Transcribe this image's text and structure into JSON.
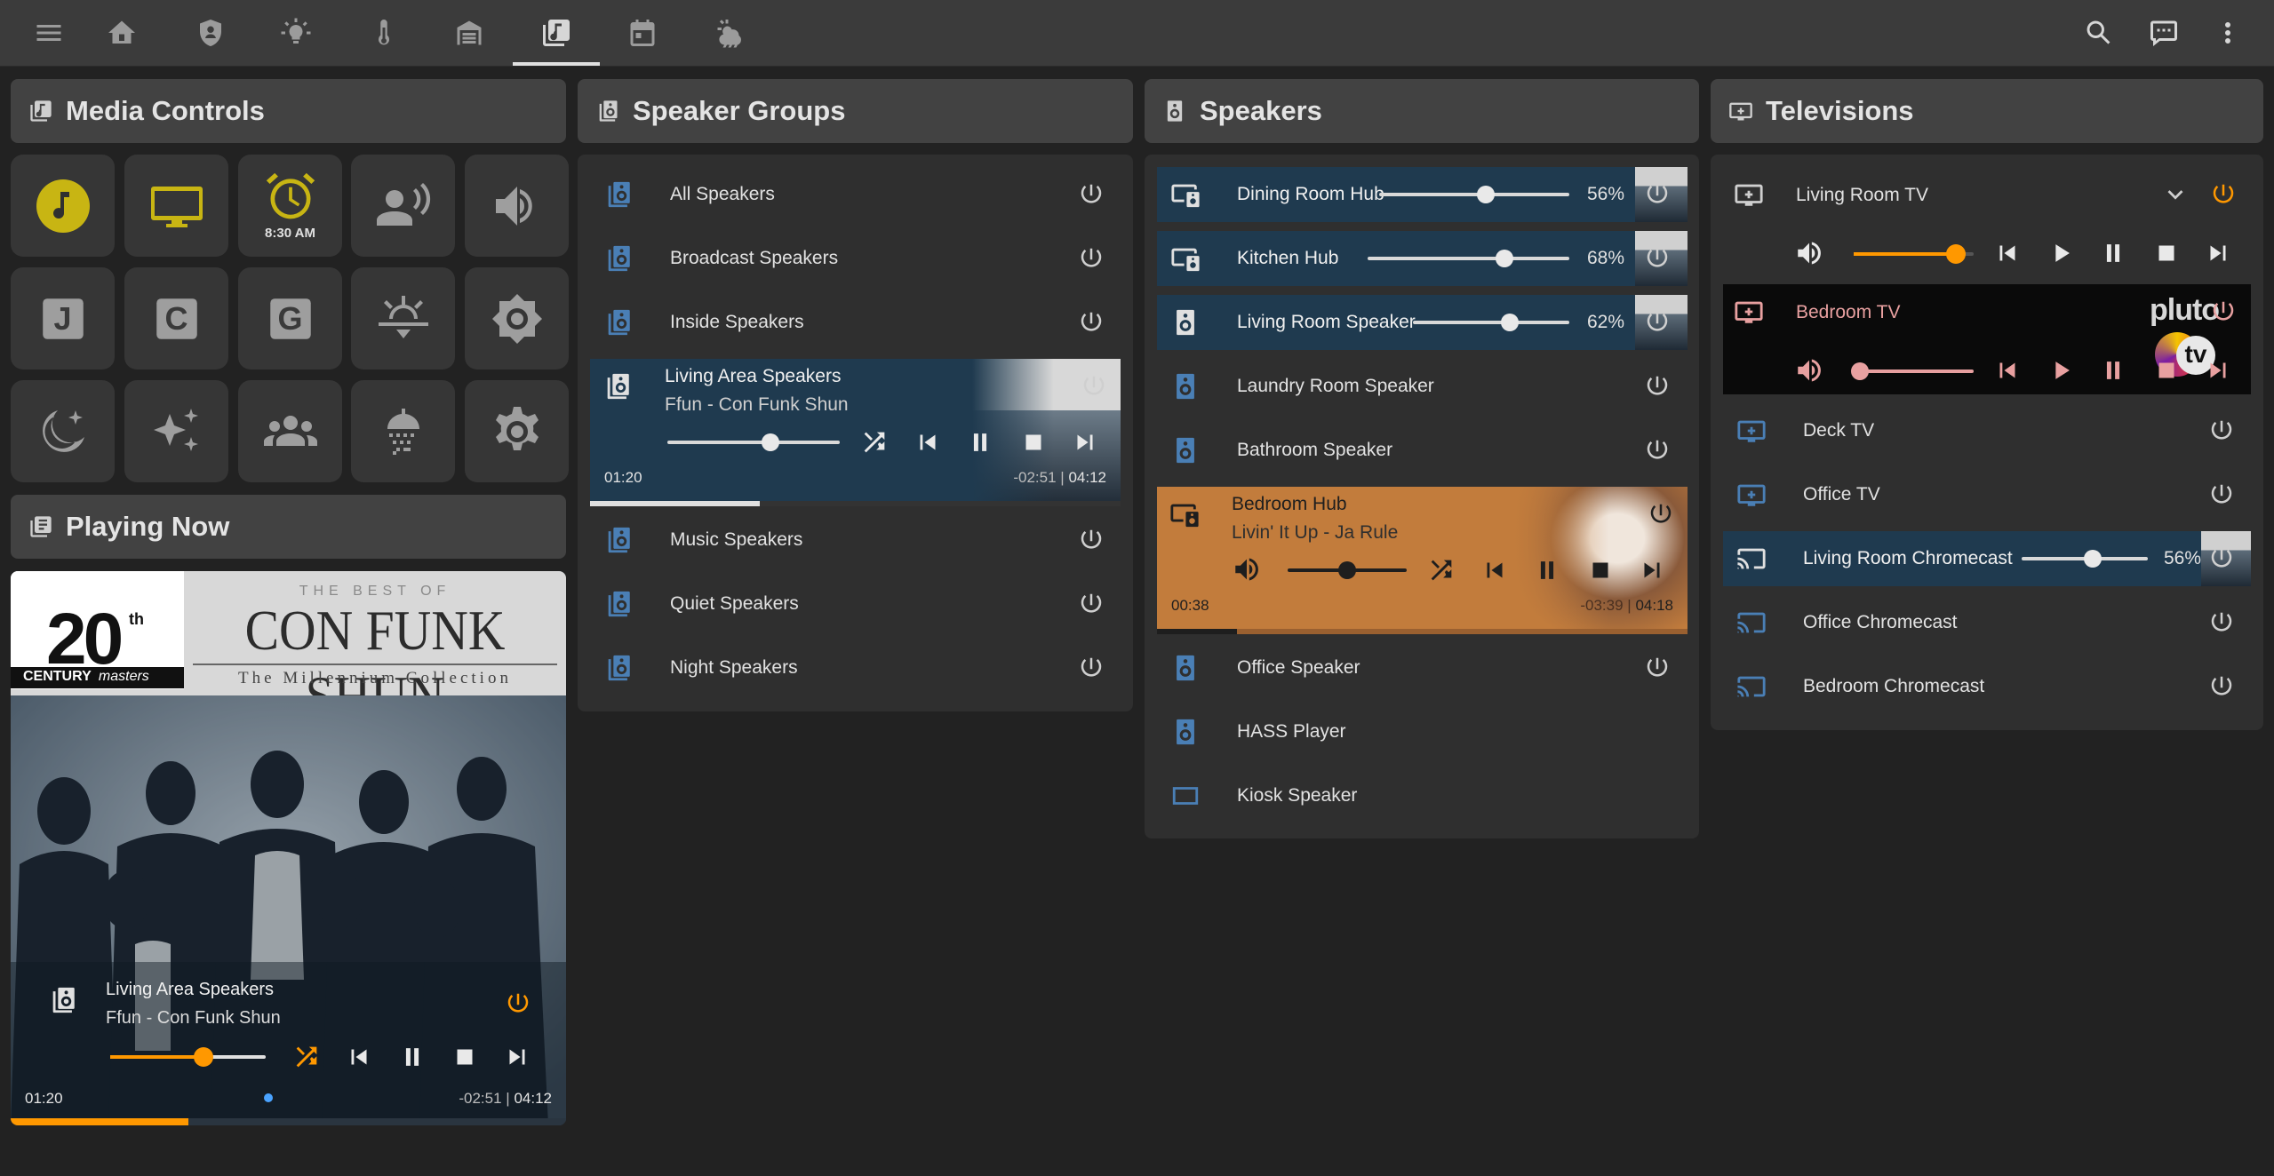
{
  "colors": {
    "accent": "#f5a623",
    "active_orange": "#ff9800",
    "icon_blue": "#4a7fb5",
    "dark_row": "#1f3a4f",
    "yellow": "#c8b513",
    "bedroom_bg": "#c27c3c"
  },
  "topbar": {
    "icons": [
      "menu-icon",
      "home-icon",
      "shield-icon",
      "lightbulb-icon",
      "thermometer-icon",
      "garage-icon",
      "music-icon",
      "calendar-icon",
      "weather-icon"
    ],
    "active_index": 6,
    "right_icons": [
      "search-icon",
      "chat-icon",
      "dots-vertical-icon"
    ]
  },
  "media_controls": {
    "title": "Media Controls",
    "alarm_time": "8:30 AM",
    "tiles": [
      "music-note-icon",
      "monitor-icon",
      "alarm-clock-icon",
      "voice-person-icon",
      "volume-icon",
      "letter-j-icon",
      "letter-c-icon",
      "letter-g-icon",
      "sunset-icon",
      "brightness-icon",
      "moon-star-icon",
      "sparkles-icon",
      "people-icon",
      "shower-icon",
      "settings-cog-icon"
    ],
    "letters": {
      "j": "J",
      "c": "C",
      "g": "G"
    }
  },
  "playing_now": {
    "title": "Playing Now",
    "player_name": "Living Area Speakers",
    "track": "Ffun - Con Funk Shun",
    "elapsed": "01:20",
    "remaining": "-02:51",
    "duration": "04:12",
    "separator": "|",
    "volume": 0.6,
    "progress": 0.32,
    "album": {
      "top": "THE BEST OF",
      "artist": "CON FUNK SHUN",
      "subtitle": "The Millennium Collection",
      "num": "20",
      "sup": "th",
      "century": "CENTURY",
      "masters": "masters"
    }
  },
  "speaker_groups": {
    "title": "Speaker Groups",
    "items_top": [
      {
        "name": "All Speakers"
      },
      {
        "name": "Broadcast Speakers"
      },
      {
        "name": "Inside Speakers"
      }
    ],
    "active": {
      "name": "Living Area Speakers",
      "track": "Ffun - Con Funk Shun",
      "elapsed": "01:20",
      "remaining": "-02:51",
      "duration": "04:12",
      "sep": "|",
      "volume": 0.6,
      "progress": 0.32
    },
    "items_bottom": [
      {
        "name": "Music Speakers"
      },
      {
        "name": "Quiet Speakers"
      },
      {
        "name": "Night Speakers"
      }
    ]
  },
  "speakers": {
    "title": "Speakers",
    "dark_rows": [
      {
        "name": "Dining Room Hub",
        "pct": "56%",
        "vol": 0.56
      },
      {
        "name": "Kitchen Hub",
        "pct": "68%",
        "vol": 0.68
      },
      {
        "name": "Living Room Speaker",
        "pct": "62%",
        "vol": 0.62
      }
    ],
    "plain_rows_top": [
      {
        "name": "Laundry Room Speaker"
      },
      {
        "name": "Bathroom Speaker"
      }
    ],
    "bedroom": {
      "name": "Bedroom Hub",
      "track": "Livin' It Up - Ja Rule",
      "elapsed": "00:38",
      "remaining": "-03:39",
      "duration": "04:18",
      "sep": "|",
      "volume": 0.5,
      "progress": 0.15
    },
    "plain_rows_bottom": [
      {
        "name": "Office Speaker"
      },
      {
        "name": "HASS Player"
      },
      {
        "name": "Kiosk Speaker"
      }
    ]
  },
  "televisions": {
    "title": "Televisions",
    "living_room_tv": {
      "name": "Living Room TV",
      "volume": 0.85
    },
    "bedroom_tv": {
      "name": "Bedroom TV",
      "volume": 0.05,
      "logo": "pluto",
      "logo_tv": "tv"
    },
    "rows": [
      {
        "name": "Deck TV"
      },
      {
        "name": "Office TV"
      }
    ],
    "chromecast": {
      "name": "Living Room Chromecast",
      "pct": "56%",
      "vol": 0.56
    },
    "rows2": [
      {
        "name": "Office Chromecast"
      },
      {
        "name": "Bedroom Chromecast"
      }
    ]
  }
}
